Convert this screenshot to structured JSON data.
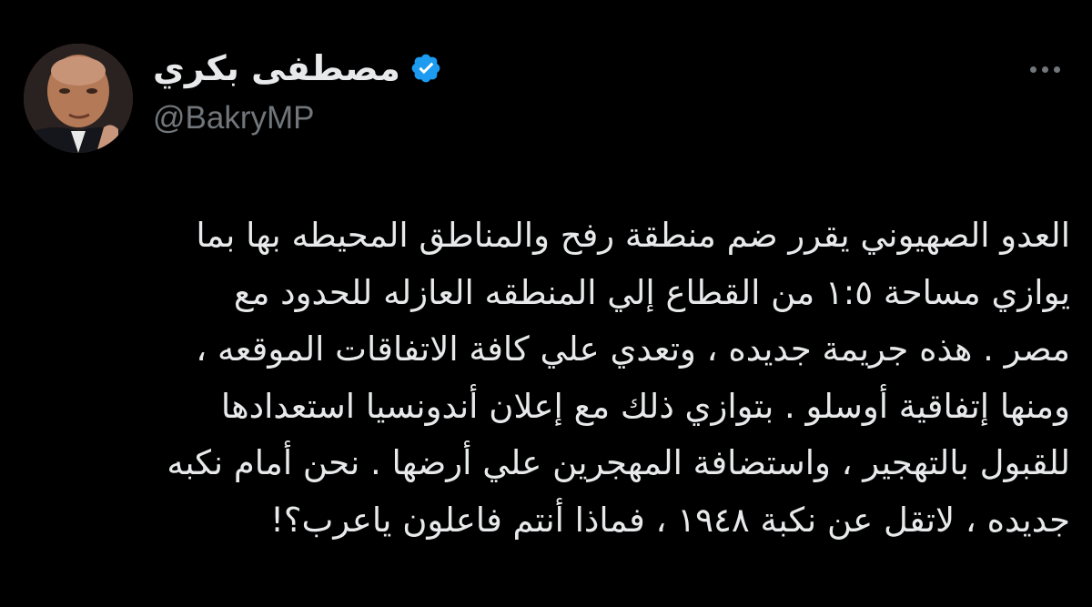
{
  "author": {
    "display_name": "مصطفى بكري",
    "handle": "@BakryMP",
    "verified": true,
    "avatar_icon": "profile-photo"
  },
  "tweet": {
    "lines": [
      "العدو الصهيوني يقرر ضم منطقة رفح والمناطق المحيطه بها بما",
      "يوازي مساحة ١:٥ من القطاع إلي المنطقه العازله للحدود مع",
      "مصر . هذه جريمة جديده ، وتعدي علي كافة الاتفاقات الموقعه ،",
      "ومنها إتفاقية أوسلو . بتوازي ذلك مع إعلان أندونسيا استعدادها",
      "للقبول بالتهجير ، واستضافة المهجرين علي أرضها . نحن أمام نكبه",
      "جديده ، لاتقل عن نكبة ١٩٤٨ ، فماذا أنتم فاعلون ياعرب؟!"
    ]
  },
  "controls": {
    "more_icon": "more-horizontal-icon"
  },
  "colors": {
    "background": "#000000",
    "text_primary": "#e7e9ea",
    "text_secondary": "#71767b",
    "verified_badge": "#1d9bf0"
  }
}
